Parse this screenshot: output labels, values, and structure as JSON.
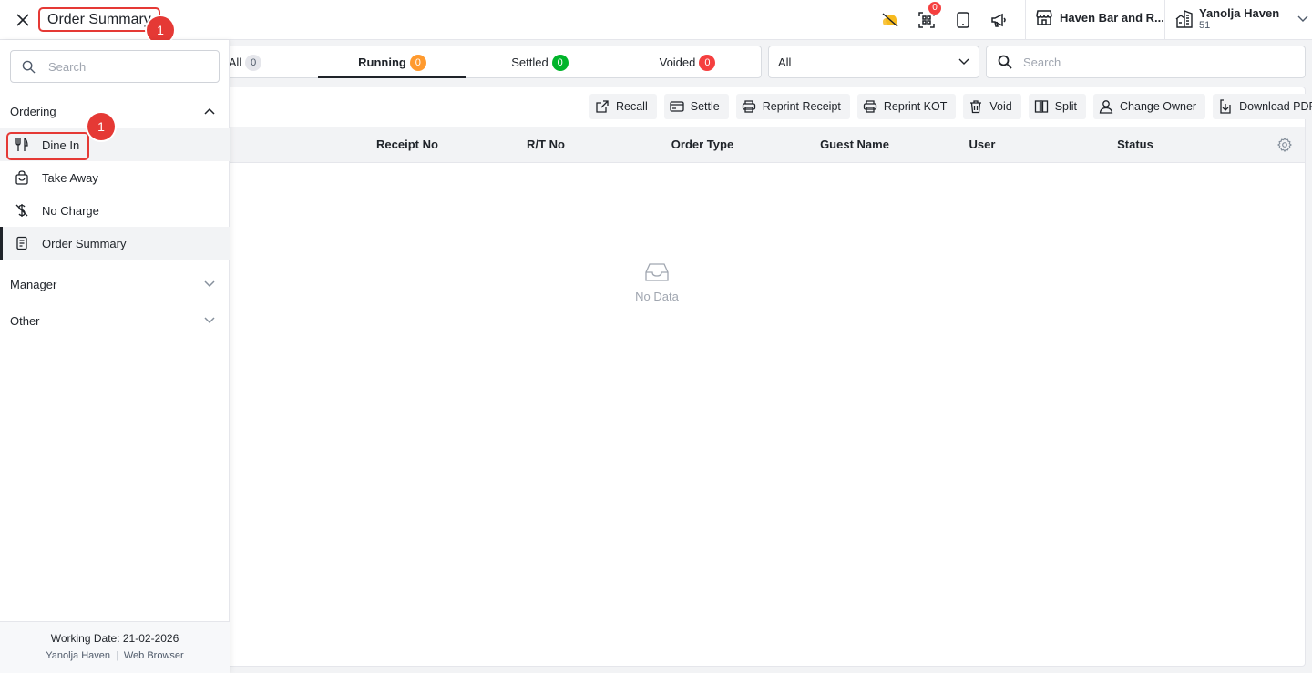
{
  "header": {
    "title": "Order Summary",
    "marker_title": "1",
    "notif_count": "0",
    "outlet": "Haven Bar and R...",
    "property_name": "Yanolja Haven",
    "property_sub": "51"
  },
  "sidebar": {
    "search_placeholder": "Search",
    "groups": {
      "ordering": "Ordering",
      "manager": "Manager",
      "other": "Other"
    },
    "items": {
      "dine_in": "Dine In",
      "take_away": "Take Away",
      "no_charge": "No Charge",
      "order_summary": "Order Summary"
    },
    "marker_dine_in": "1",
    "footer": {
      "working_date": "Working Date: 21-02-2026",
      "property": "Yanolja Haven",
      "platform": "Web Browser"
    }
  },
  "tabs": {
    "all": {
      "label": "All",
      "count": "0"
    },
    "running": {
      "label": "Running",
      "count": "0"
    },
    "settled": {
      "label": "Settled",
      "count": "0"
    },
    "voided": {
      "label": "Voided",
      "count": "0"
    }
  },
  "filter": {
    "selected": "All"
  },
  "search": {
    "placeholder": "Search"
  },
  "actions": {
    "recall": "Recall",
    "settle": "Settle",
    "reprint_receipt": "Reprint Receipt",
    "reprint_kot": "Reprint KOT",
    "void": "Void",
    "split": "Split",
    "change_owner": "Change Owner",
    "download_pdf": "Download PDF"
  },
  "table": {
    "columns": {
      "receipt_no": "Receipt No",
      "rt_no": "R/T No",
      "order_type": "Order Type",
      "guest_name": "Guest Name",
      "user": "User",
      "status": "Status"
    },
    "empty_text": "No Data"
  },
  "colors": {
    "marker": "#e53935",
    "running_badge": "#ff9a2e",
    "settled_badge": "#00b42a",
    "voided_badge": "#f53f3f",
    "all_badge": "#c9cdd4",
    "weather_icon": "#f7ba1e"
  },
  "icons": [
    "close-icon",
    "weather-icon",
    "qr-scan-icon",
    "tablet-icon",
    "megaphone-icon",
    "store-icon",
    "building-icon",
    "chevron-down-icon",
    "search-icon",
    "chevron-up-icon",
    "dine-in-icon",
    "take-away-icon",
    "no-charge-icon",
    "order-summary-icon",
    "recall-icon",
    "settle-icon",
    "print-icon",
    "trash-icon",
    "split-icon",
    "user-icon",
    "download-icon",
    "gear-icon",
    "inbox-icon"
  ]
}
